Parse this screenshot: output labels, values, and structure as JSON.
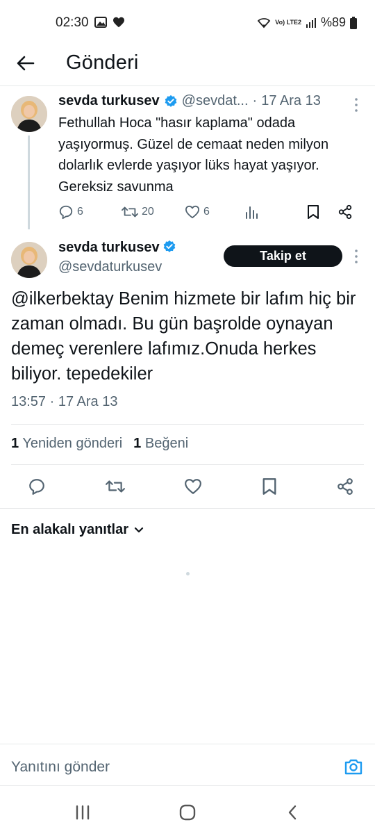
{
  "status_bar": {
    "time": "02:30",
    "network": "Vo) LTE2",
    "battery": "%89"
  },
  "header": {
    "title": "Gönderi"
  },
  "quoted_tweet": {
    "name": "sevda turkusev",
    "handle": "@sevdat...",
    "separator": "·",
    "date": "17 Ara 13",
    "text": "Fethullah Hoca \"hasır kaplama\" odada yaşıyormuş. Güzel de cemaat neden milyon dolarlık evlerde yaşıyor lüks hayat yaşıyor. Gereksiz savunma",
    "replies": "6",
    "retweets": "20",
    "likes": "6"
  },
  "main_tweet": {
    "name": "sevda turkusev",
    "handle": "@sevdaturkusev",
    "follow_label": "Takip et",
    "text": "@ilkerbektay Benim hizmete bir lafım hiç bir zaman olmadı. Bu gün başrolde oynayan demeç verenlere lafımız.Onuda herkes biliyor. tepedekiler",
    "timestamp": "13:57 · 17 Ara 13",
    "retweet_count": "1",
    "retweet_label": "Yeniden gönderi",
    "like_count": "1",
    "like_label": "Beğeni"
  },
  "replies_sort": {
    "label": "En alakalı yanıtlar"
  },
  "reply_bar": {
    "placeholder": "Yanıtını gönder"
  },
  "colors": {
    "text": "#0f1419",
    "muted": "#536471",
    "verified": "#1d9bf0",
    "divider": "#e7e9ea"
  },
  "icons": [
    "back-arrow-icon",
    "reply-icon",
    "retweet-icon",
    "like-icon",
    "views-icon",
    "bookmark-icon",
    "share-icon",
    "more-icon",
    "verified-icon",
    "chevron-down-icon",
    "camera-icon"
  ]
}
